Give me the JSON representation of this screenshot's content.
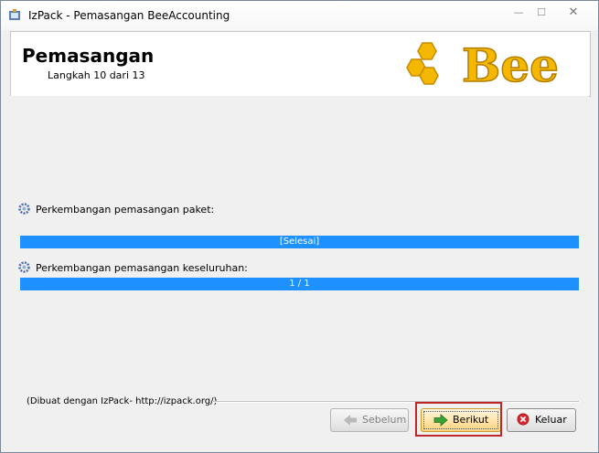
{
  "window": {
    "title": "IzPack - Pemasangan BeeAccounting",
    "controls": {
      "minimize": "—",
      "maximize": "☐",
      "close": "✕"
    }
  },
  "header": {
    "title": "Pemasangan",
    "step": "Langkah 10 dari 13",
    "logo_text": "Bee",
    "logo_color": "#f0a500"
  },
  "progress": {
    "package": {
      "label": "Perkembangan pemasangan paket:",
      "text": "[Selesai]",
      "value": 1.0
    },
    "overall": {
      "label": "Perkembangan pemasangan keseluruhan:",
      "text": "1 / 1",
      "value": 1.0
    },
    "bar_color": "#1e90ff"
  },
  "footer": {
    "credit": "(Dibuat dengan IzPack- http://izpack.org/)"
  },
  "buttons": {
    "previous": {
      "label": "Sebelum",
      "icon": "arrow-left-icon",
      "enabled": false
    },
    "next": {
      "label": "Berikut",
      "icon": "arrow-right-icon",
      "enabled": true
    },
    "quit": {
      "label": "Keluar",
      "icon": "close-circle-icon",
      "enabled": true
    }
  },
  "highlight_color": "#c0272d"
}
